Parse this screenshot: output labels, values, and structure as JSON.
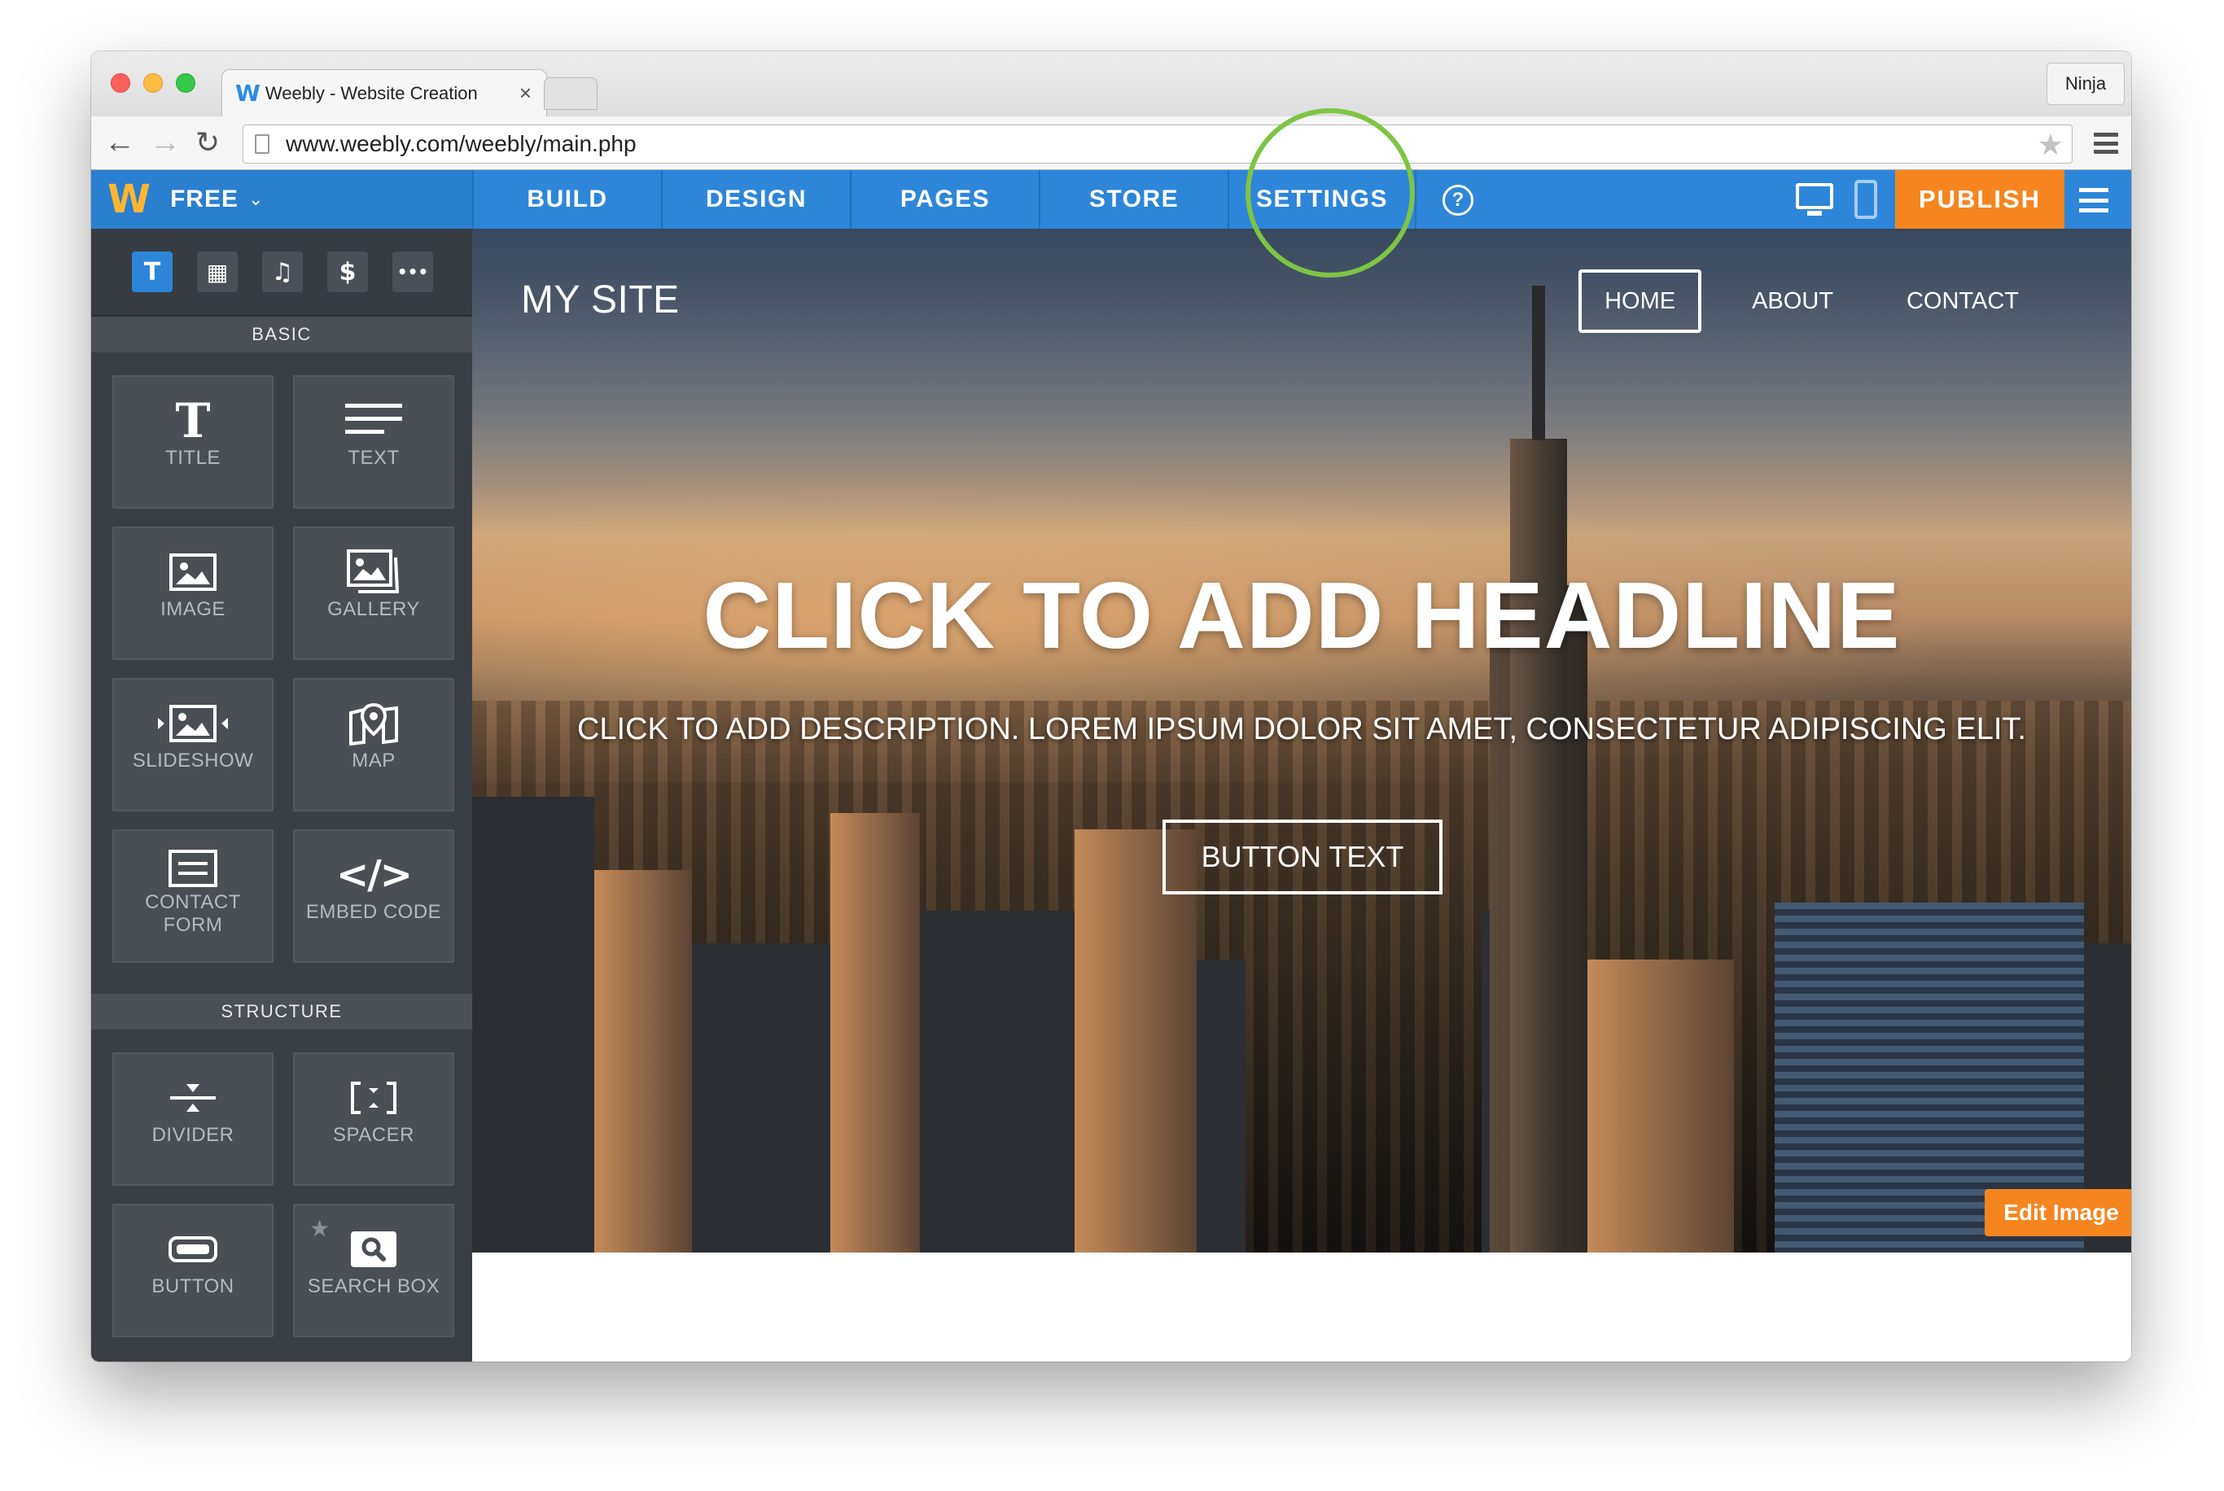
{
  "browser": {
    "tab_title": "Weebly - Website Creation",
    "tab_favicon": "W",
    "tab_close": "×",
    "profile_name": "Ninja",
    "url": "www.weebly.com/weebly/main.php",
    "icons": {
      "back": "←",
      "forward": "→",
      "reload": "↻",
      "star": "★"
    }
  },
  "editor_bar": {
    "logo": "W",
    "plan": "FREE",
    "plan_caret": "⌄",
    "tabs": [
      {
        "label": "BUILD"
      },
      {
        "label": "DESIGN"
      },
      {
        "label": "PAGES"
      },
      {
        "label": "STORE"
      },
      {
        "label": "SETTINGS"
      }
    ],
    "help": "?",
    "publish_label": "PUBLISH",
    "colors": {
      "bar": "#2d86d9",
      "publish": "#f6851f",
      "highlight_circle": "#7dc545"
    }
  },
  "sidebar": {
    "tools": [
      {
        "glyph": "T",
        "icon": "text-tool-icon"
      },
      {
        "glyph": "▦",
        "icon": "layout-tool-icon"
      },
      {
        "glyph": "♫",
        "icon": "media-tool-icon"
      },
      {
        "glyph": "$",
        "icon": "commerce-tool-icon"
      },
      {
        "glyph": "•••",
        "icon": "more-tool-icon"
      }
    ],
    "basic_heading": "BASIC",
    "basic_items": [
      {
        "label": "TITLE",
        "icon": "title-icon"
      },
      {
        "label": "TEXT",
        "icon": "text-icon"
      },
      {
        "label": "IMAGE",
        "icon": "image-icon"
      },
      {
        "label": "GALLERY",
        "icon": "gallery-icon"
      },
      {
        "label": "SLIDESHOW",
        "icon": "slideshow-icon"
      },
      {
        "label": "MAP",
        "icon": "map-icon"
      },
      {
        "label": "CONTACT FORM",
        "icon": "contact-form-icon"
      },
      {
        "label": "EMBED CODE",
        "icon": "embed-code-icon"
      }
    ],
    "structure_heading": "STRUCTURE",
    "structure_items": [
      {
        "label": "DIVIDER",
        "icon": "divider-icon"
      },
      {
        "label": "SPACER",
        "icon": "spacer-icon"
      },
      {
        "label": "BUTTON",
        "icon": "button-icon"
      },
      {
        "label": "SEARCH BOX",
        "icon": "search-box-icon"
      }
    ]
  },
  "site": {
    "title": "MY SITE",
    "nav": [
      "HOME",
      "ABOUT",
      "CONTACT"
    ],
    "headline": "CLICK TO ADD HEADLINE",
    "description": "CLICK TO ADD DESCRIPTION. LOREM IPSUM DOLOR SIT AMET, CONSECTETUR ADIPISCING ELIT.",
    "button_text": "BUTTON TEXT",
    "edit_image_label": "Edit Image",
    "gear": "⚙"
  }
}
